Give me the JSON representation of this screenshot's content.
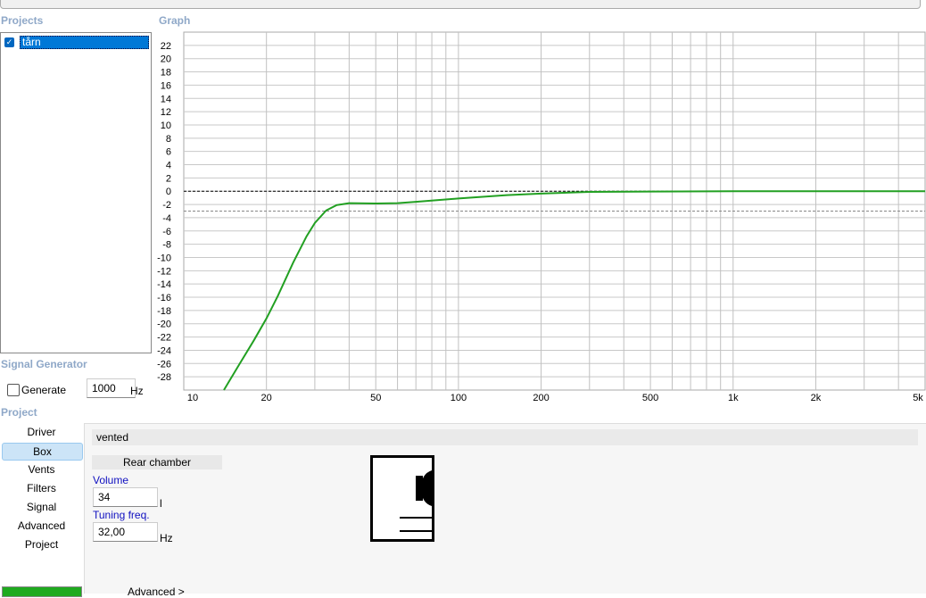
{
  "sections": {
    "projects": "Projects",
    "graph": "Graph",
    "signal_generator": "Signal Generator",
    "project": "Project"
  },
  "projects": [
    {
      "name": "tårn",
      "checked": true
    }
  ],
  "signal": {
    "generate_label": "Generate",
    "generate_checked": false,
    "frequency": "1000",
    "unit": "Hz"
  },
  "nav": [
    "Driver",
    "Box",
    "Vents",
    "Filters",
    "Signal",
    "Advanced",
    "Project"
  ],
  "nav_selected": 1,
  "box": {
    "type": "vented",
    "chamber": "Rear chamber",
    "volume_label": "Volume",
    "volume": "34",
    "volume_unit": "l",
    "tuning_label": "Tuning freq.",
    "tuning": "32,00",
    "tuning_unit": "Hz",
    "advanced": "Advanced >"
  },
  "chart_data": {
    "type": "line",
    "xscale": "log",
    "xlim": [
      10,
      5000
    ],
    "ylim": [
      -30,
      24
    ],
    "xticks": [
      10,
      20,
      50,
      100,
      200,
      500,
      1000,
      2000,
      5000
    ],
    "xticklabels": [
      "10",
      "20",
      "50",
      "100",
      "200",
      "500",
      "1k",
      "2k",
      "5k"
    ],
    "yticks": [
      22,
      20,
      18,
      16,
      14,
      12,
      10,
      8,
      6,
      4,
      2,
      0,
      -2,
      -4,
      -6,
      -8,
      -10,
      -12,
      -14,
      -16,
      -18,
      -20,
      -22,
      -24,
      -26,
      -28
    ],
    "reference_lines": [
      {
        "y": 0,
        "color": "#000000"
      },
      {
        "y": -3,
        "color": "#888888"
      }
    ],
    "series": [
      {
        "name": "tårn",
        "color": "#22a022",
        "x": [
          14,
          16,
          18,
          20,
          22,
          25,
          28,
          30,
          33,
          36,
          40,
          50,
          60,
          70,
          100,
          150,
          200,
          300,
          500,
          1000,
          5000
        ],
        "y": [
          -30,
          -26,
          -22.5,
          -19.2,
          -15.8,
          -10.8,
          -6.8,
          -4.8,
          -2.9,
          -2.1,
          -1.8,
          -1.85,
          -1.8,
          -1.6,
          -1.1,
          -0.6,
          -0.35,
          -0.1,
          -0.05,
          0,
          0
        ]
      }
    ]
  }
}
